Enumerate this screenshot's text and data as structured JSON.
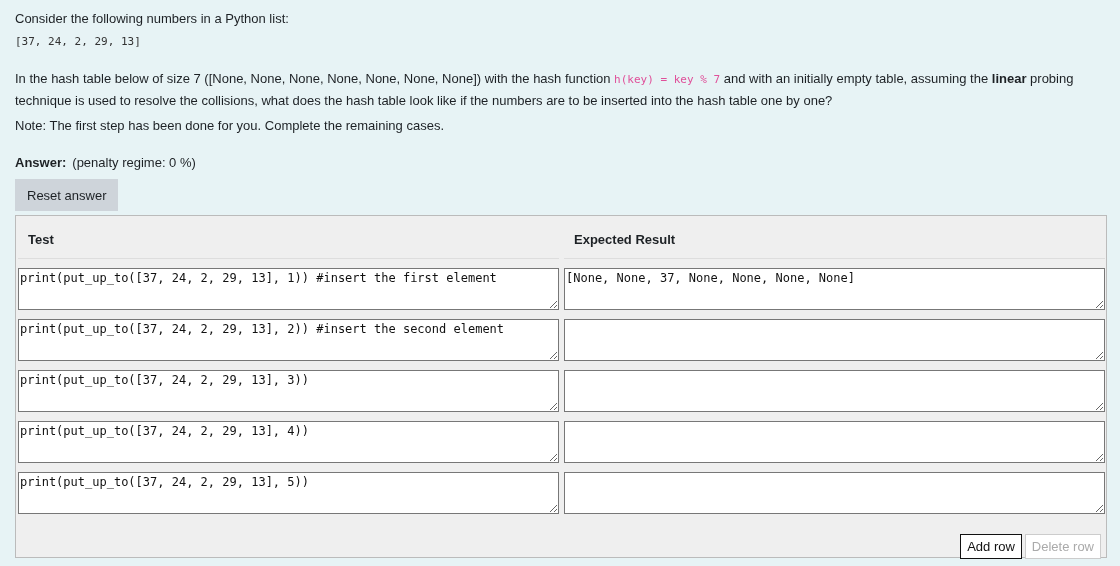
{
  "intro": "Consider the following numbers in a Python list:",
  "numbers": "[37, 24, 2, 29, 13]",
  "question": {
    "before": "In the hash table below of size 7 ([None, None, None, None, None, None, None]) with the hash function",
    "code": "h(key) = key % 7",
    "after": "and with an initially empty table, assuming the **linear** probing technique is used to resolve the collisions, what does the hash table look like if the numbers are to be inserted into the hash table one by one?"
  },
  "note": "Note: The first step has been done for you. Complete the remaining cases.",
  "answer": {
    "label": "Answer:",
    "penalty": "(penalty regime: 0 %)"
  },
  "reset_button": "Reset answer",
  "table": {
    "columns": [
      "Test",
      "Expected Result"
    ],
    "rows": [
      {
        "test": "print(put_up_to([37, 24, 2, 29, 13], 1)) #insert the first element",
        "expected": "[None, None, 37, None, None, None, None]"
      },
      {
        "test": "print(put_up_to([37, 24, 2, 29, 13], 2)) #insert the second element",
        "expected": ""
      },
      {
        "test": "print(put_up_to([37, 24, 2, 29, 13], 3))",
        "expected": ""
      },
      {
        "test": "print(put_up_to([37, 24, 2, 29, 13], 4))",
        "expected": ""
      },
      {
        "test": "print(put_up_to([37, 24, 2, 29, 13], 5))",
        "expected": ""
      }
    ],
    "buttons": [
      {
        "label": "Add row",
        "disabled": false
      },
      {
        "label": "Delete row",
        "disabled": true
      }
    ]
  }
}
